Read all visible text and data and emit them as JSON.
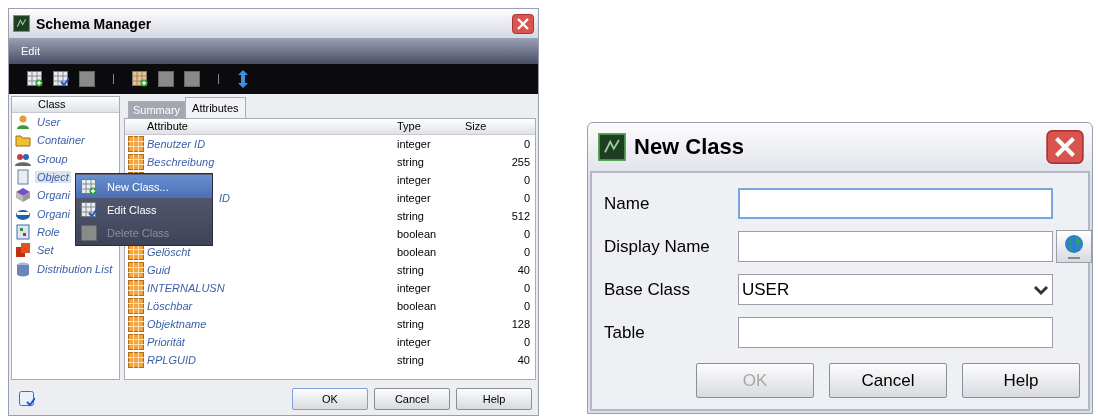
{
  "schema_manager": {
    "title": "Schema Manager",
    "menu": [
      "Edit"
    ],
    "toolbar": [
      {
        "kind": "button",
        "disabled": false
      },
      {
        "kind": "button",
        "disabled": false
      },
      {
        "kind": "button",
        "disabled": true
      },
      {
        "kind": "separator"
      },
      {
        "kind": "button",
        "disabled": false
      },
      {
        "kind": "button",
        "disabled": true
      },
      {
        "kind": "button",
        "disabled": true
      },
      {
        "kind": "separator"
      },
      {
        "kind": "button",
        "disabled": false
      }
    ],
    "class_list": {
      "header": "Class",
      "items": [
        {
          "label": "User",
          "selected": false
        },
        {
          "label": "Container",
          "selected": false
        },
        {
          "label": "Group",
          "selected": false
        },
        {
          "label": "Object",
          "selected": true
        },
        {
          "label": "Organi",
          "selected": false
        },
        {
          "label": "Organi",
          "selected": false
        },
        {
          "label": "Role",
          "selected": false
        },
        {
          "label": "Set",
          "selected": false
        },
        {
          "label": "Distribution List",
          "selected": false
        }
      ]
    },
    "tabs": [
      {
        "label": "Summary",
        "selected": false
      },
      {
        "label": "Attributes",
        "selected": true
      }
    ],
    "table": {
      "columns": [
        "Attribute",
        "Type",
        "Size"
      ],
      "rows": [
        {
          "name": "Benutzer ID",
          "type": "integer",
          "size": "0"
        },
        {
          "name": "Beschreibung",
          "type": "string",
          "size": "255"
        },
        {
          "type": "integer",
          "size": "0"
        },
        {
          "name_tail": "ID",
          "type": "integer",
          "size": "0"
        },
        {
          "type": "string",
          "size": "512"
        },
        {
          "type": "boolean",
          "size": "0"
        },
        {
          "name": "Gelöscht",
          "type": "boolean",
          "size": "0"
        },
        {
          "name": "Guid",
          "type": "string",
          "size": "40"
        },
        {
          "name": "INTERNALUSN",
          "type": "integer",
          "size": "0"
        },
        {
          "name": "Löschbar",
          "type": "boolean",
          "size": "0"
        },
        {
          "name": "Objektname",
          "type": "string",
          "size": "128"
        },
        {
          "name": "Priorität",
          "type": "integer",
          "size": "0"
        },
        {
          "name": "RPLGUID",
          "type": "string",
          "size": "40"
        }
      ]
    },
    "context_menu": [
      {
        "label": "New Class...",
        "selected": true,
        "disabled": false
      },
      {
        "label": "Edit Class",
        "selected": false,
        "disabled": false
      },
      {
        "label": "Delete Class",
        "selected": false,
        "disabled": true
      }
    ],
    "buttons": [
      {
        "label": "OK",
        "disabled": false
      },
      {
        "label": "Cancel",
        "disabled": false
      },
      {
        "label": "Help",
        "disabled": false
      }
    ]
  },
  "new_class": {
    "title": "New Class",
    "fields": [
      {
        "label": "Name",
        "kind": "text",
        "focused": true
      },
      {
        "label": "Display Name",
        "kind": "text-globe",
        "focused": false
      },
      {
        "label": "Base Class",
        "kind": "combo",
        "value": "USER",
        "focused": false
      },
      {
        "label": "Table",
        "kind": "text",
        "focused": false
      }
    ],
    "buttons": [
      {
        "label": "OK",
        "disabled": true
      },
      {
        "label": "Cancel",
        "disabled": false
      },
      {
        "label": "Help",
        "disabled": false
      }
    ]
  }
}
